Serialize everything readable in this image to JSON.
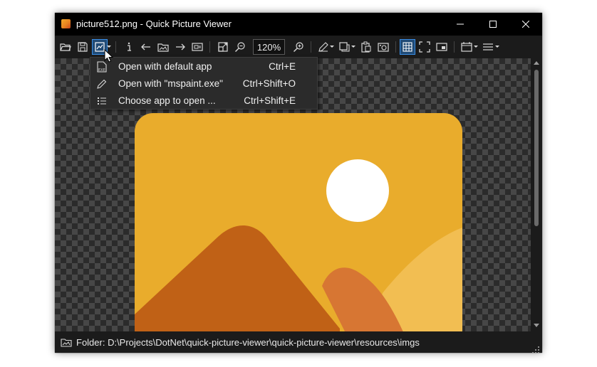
{
  "window": {
    "title": "picture512.png - Quick Picture Viewer",
    "icon": "picture-app-icon"
  },
  "toolbar": {
    "zoom_value": "120%",
    "active_buttons": [
      "open-with-button",
      "checkerboard-button"
    ],
    "accent_color": "#3a8ee6",
    "items": [
      "open-folder-icon",
      "save-icon",
      "open-with-icon",
      "info-icon",
      "previous-icon",
      "gallery-icon",
      "next-icon",
      "slideshow-icon",
      "resize-icon",
      "zoom-out-icon",
      "zoom-in-icon",
      "edit-icon",
      "transform-icon",
      "clipboard-icon",
      "screenshot-icon",
      "checkerboard-icon",
      "fullscreen-icon",
      "picture-in-picture-icon",
      "calendar-icon",
      "menu-icon"
    ]
  },
  "context_menu": {
    "items": [
      {
        "icon": "exe-file-icon",
        "label": "Open with default app",
        "shortcut": "Ctrl+E"
      },
      {
        "icon": "pencil-icon",
        "label": "Open with \"mspaint.exe\"",
        "shortcut": "Ctrl+Shift+O"
      },
      {
        "icon": "list-icon",
        "label": "Choose app to open ...",
        "shortcut": "Ctrl+Shift+E"
      }
    ]
  },
  "image": {
    "description_colors": {
      "background": "#e9ac2c",
      "sun": "#ffffff",
      "mountain_left": "#c06116",
      "mountain_middle": "#d77633",
      "hill_right": "#f2be52"
    }
  },
  "statusbar": {
    "folder_text": "Folder: D:\\Projects\\DotNet\\quick-picture-viewer\\quick-picture-viewer\\resources\\imgs"
  }
}
